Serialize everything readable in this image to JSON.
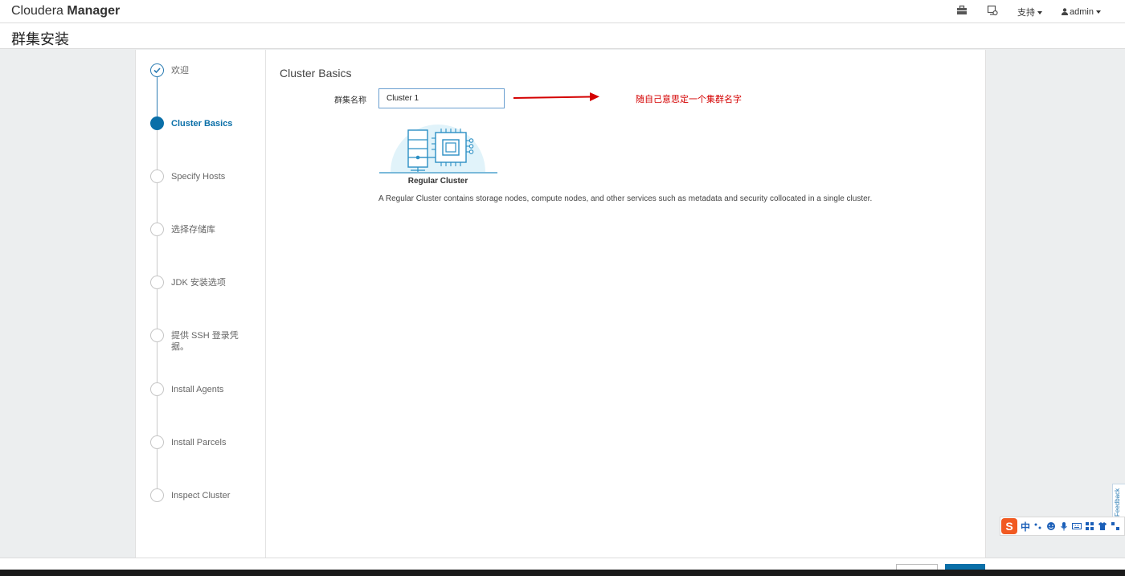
{
  "topnav": {
    "brand_light": "Cloudera",
    "brand_bold": "Manager",
    "support_label": "支持",
    "user_label": "admin"
  },
  "page": {
    "title": "群集安装"
  },
  "steps": [
    {
      "label": "欢迎",
      "state": "done"
    },
    {
      "label": "Cluster Basics",
      "state": "active"
    },
    {
      "label": "Specify Hosts",
      "state": "pending"
    },
    {
      "label": "选择存储库",
      "state": "pending"
    },
    {
      "label": "JDK 安装选项",
      "state": "pending"
    },
    {
      "label": "提供 SSH 登录凭据。",
      "state": "pending"
    },
    {
      "label": "Install Agents",
      "state": "pending"
    },
    {
      "label": "Install Parcels",
      "state": "pending"
    },
    {
      "label": "Inspect Cluster",
      "state": "pending"
    }
  ],
  "content": {
    "section_title": "Cluster Basics",
    "cluster_name_label": "群集名称",
    "cluster_name_value": "Cluster 1",
    "annotation": "随自己意思定一个集群名字",
    "cluster_type_name": "Regular Cluster",
    "cluster_type_desc": "A Regular Cluster contains storage nodes, compute nodes, and other services such as metadata and security collocated in a single cluster."
  },
  "feedback_label": "Feedback",
  "ime": {
    "logo": "S",
    "lang": "中"
  },
  "colors": {
    "accent": "#0a6fa8",
    "annotation": "#d40000",
    "illustration": "#2b8fc4"
  }
}
